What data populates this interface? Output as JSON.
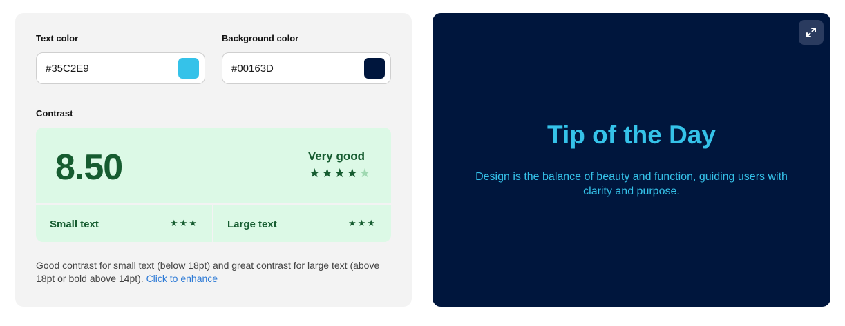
{
  "text_color": {
    "label": "Text color",
    "value": "#35C2E9",
    "swatch": "#35C2E9"
  },
  "background_color": {
    "label": "Background color",
    "value": "#00163D",
    "swatch": "#00163D"
  },
  "contrast": {
    "label": "Contrast",
    "ratio": "8.50",
    "rating": "Very good",
    "rating_stars": 4,
    "rating_stars_max": 5,
    "small_text": {
      "label": "Small text",
      "stars": 3
    },
    "large_text": {
      "label": "Large text",
      "stars": 3
    }
  },
  "description": {
    "text": "Good contrast for small text (below 18pt) and great contrast for large text (above 18pt or bold above 14pt).",
    "link": "Click to enhance"
  },
  "preview": {
    "title": "Tip of the Day",
    "body": "Design is the balance of beauty and function, guiding users with clarity and purpose.",
    "expand_icon": "expand-icon"
  },
  "colors": {
    "panel_bg": "#f3f3f3",
    "card_bg": "#dcf9e6",
    "good_green": "#165c30",
    "link_blue": "#2e7bd6",
    "expand_bg": "#2a3b5f"
  }
}
